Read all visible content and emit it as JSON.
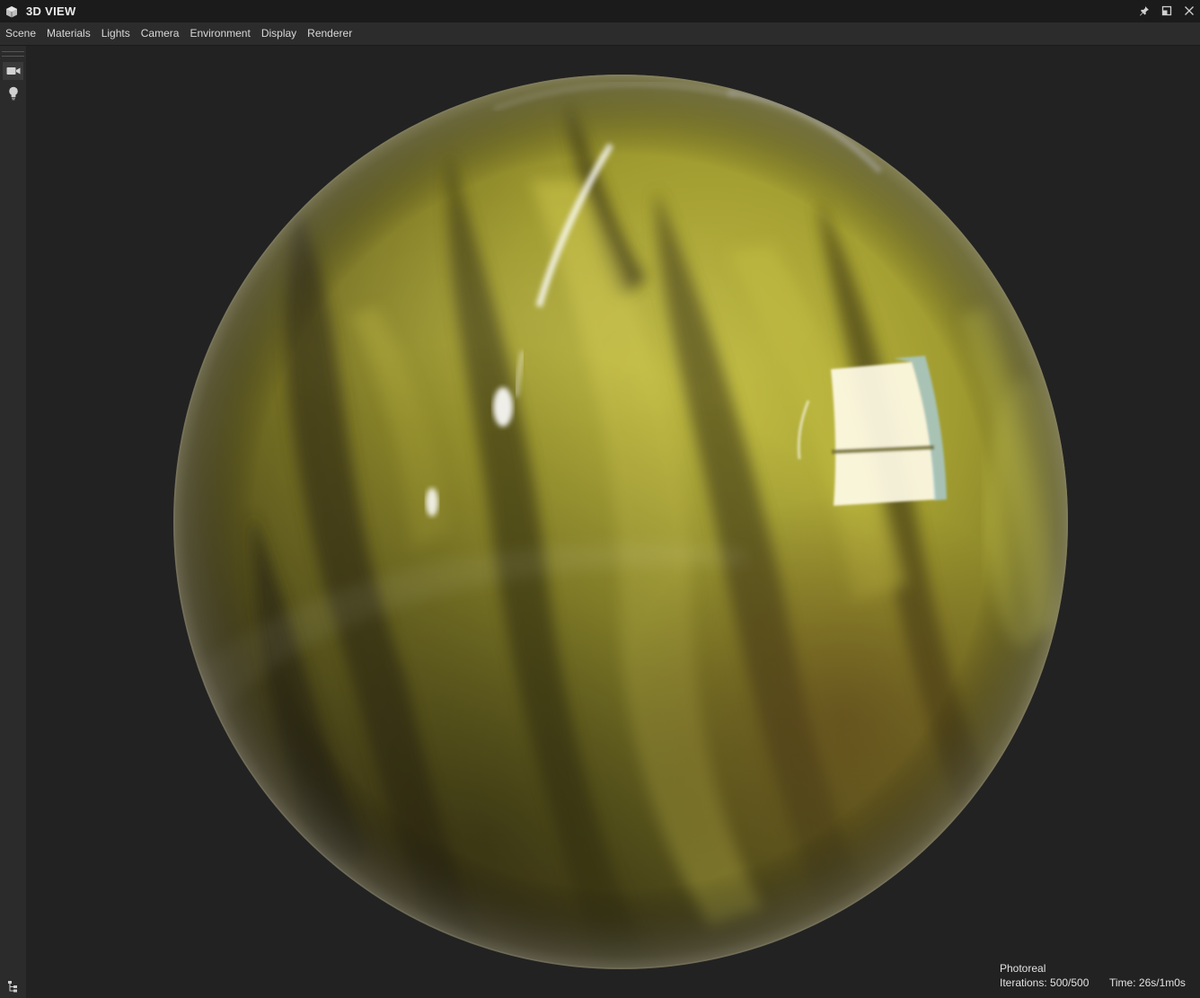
{
  "window": {
    "title": "3D VIEW",
    "icons": [
      "cube-icon",
      "pin-icon",
      "maximize-icon",
      "close-icon"
    ]
  },
  "menu": {
    "items": [
      "Scene",
      "Materials",
      "Lights",
      "Camera",
      "Environment",
      "Display",
      "Renderer"
    ]
  },
  "sidebar": {
    "buttons": [
      "camera-icon",
      "lightbulb-icon"
    ],
    "bottom_icon": "hierarchy-icon"
  },
  "viewport": {
    "content": "rendered sphere with glossy yellow-green marbled material",
    "colors": {
      "background": "#222222",
      "material_light": "#b6b23a",
      "material_mid": "#7f7a26",
      "material_dark": "#3b3417"
    }
  },
  "status": {
    "mode": "Photoreal",
    "iterations": "Iterations: 500/500",
    "time": "Time: 26s/1m0s"
  }
}
